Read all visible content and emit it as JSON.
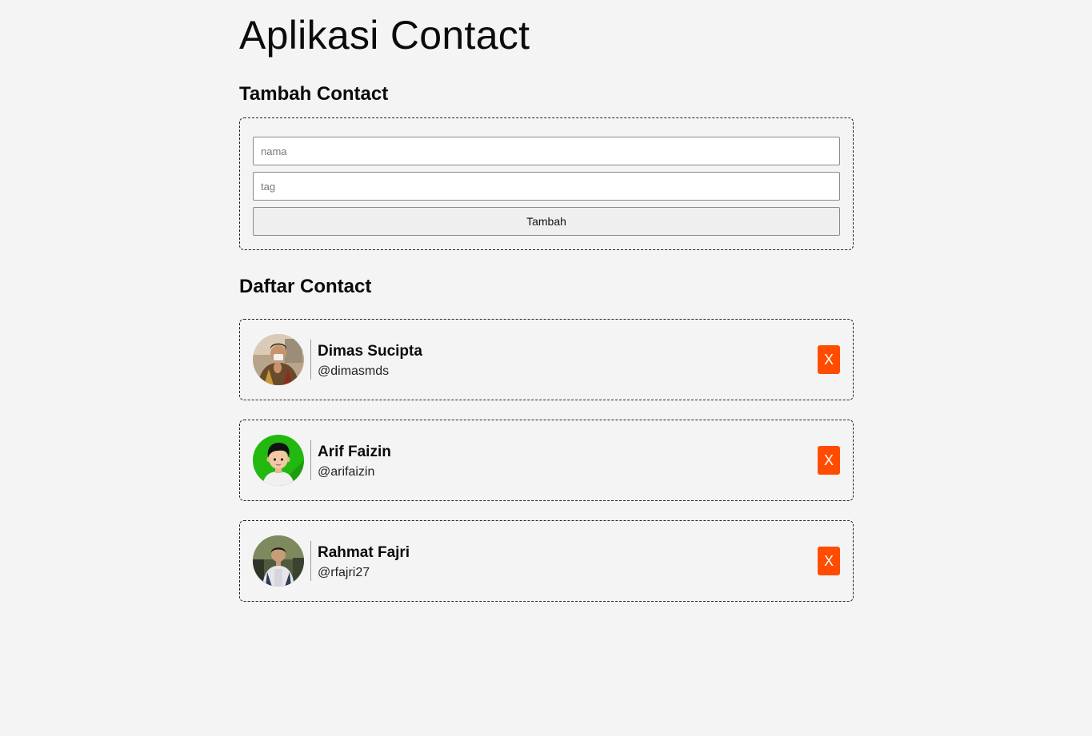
{
  "app": {
    "title": "Aplikasi Contact"
  },
  "add_section": {
    "title": "Tambah Contact",
    "name_placeholder": "nama",
    "name_value": "",
    "tag_placeholder": "tag",
    "tag_value": "",
    "submit_label": "Tambah"
  },
  "list_section": {
    "title": "Daftar Contact"
  },
  "contacts": [
    {
      "name": "Dimas Sucipta",
      "tag": "@dimasmds",
      "delete_label": "X",
      "avatar_icon": "person-photo-avatar"
    },
    {
      "name": "Arif Faizin",
      "tag": "@arifaizin",
      "delete_label": "X",
      "avatar_icon": "cartoon-avatar"
    },
    {
      "name": "Rahmat Fajri",
      "tag": "@rfajri27",
      "delete_label": "X",
      "avatar_icon": "person-photo-avatar"
    }
  ],
  "colors": {
    "background": "#f4f4f4",
    "delete_button": "#ff4c00",
    "avatar_green": "#22b80f"
  }
}
